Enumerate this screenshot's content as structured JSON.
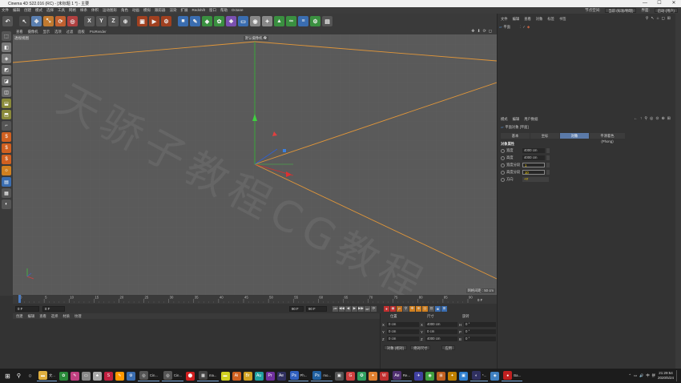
{
  "window": {
    "title": "Cinema 4D S22.016 (RC) - [未标题 1 *] - 主要",
    "controls": [
      "—",
      "☐",
      "✕"
    ]
  },
  "menubar": {
    "items": [
      "文件",
      "编辑",
      "创建",
      "模式",
      "选择",
      "工具",
      "网格",
      "样条",
      "体积",
      "运动图形",
      "角色",
      "动画",
      "模拟",
      "跟踪器",
      "渲染",
      "扩展",
      "Redshift",
      "窗口",
      "帮助",
      "Octane"
    ],
    "right": {
      "interface_label": "界面:",
      "interface_value": "启动 (用户)",
      "layout_label": "节点空间:",
      "layout_value": "当前 (标准/物理)"
    }
  },
  "toolbar": {
    "tools": [
      {
        "name": "undo",
        "glyph": "↶",
        "color": "#555"
      },
      {
        "name": "live-select",
        "glyph": "↖",
        "color": "#4a4a4a"
      },
      {
        "name": "move",
        "glyph": "✥",
        "color": "#5a7fb0"
      },
      {
        "name": "scale",
        "glyph": "⤡",
        "color": "#c07a30"
      },
      {
        "name": "rotate",
        "glyph": "⟳",
        "color": "#c06030"
      },
      {
        "name": "recent",
        "glyph": "◎",
        "color": "#b04040"
      },
      {
        "name": "axis-x",
        "glyph": "X",
        "color": "#555"
      },
      {
        "name": "axis-y",
        "glyph": "Y",
        "color": "#555"
      },
      {
        "name": "axis-z",
        "glyph": "Z",
        "color": "#555"
      },
      {
        "name": "coord",
        "glyph": "⊕",
        "color": "#555"
      },
      {
        "name": "render-region",
        "glyph": "▣",
        "color": "#a04020"
      },
      {
        "name": "render-view",
        "glyph": "▶",
        "color": "#a04020"
      },
      {
        "name": "render-settings",
        "glyph": "⚙",
        "color": "#a04020"
      },
      {
        "name": "cube",
        "glyph": "■",
        "color": "#3a6db0"
      },
      {
        "name": "pen",
        "glyph": "✎",
        "color": "#3a6db0"
      },
      {
        "name": "subdivide",
        "glyph": "◆",
        "color": "#3a9040"
      },
      {
        "name": "cloner",
        "glyph": "✿",
        "color": "#3a9040"
      },
      {
        "name": "deformer",
        "glyph": "❖",
        "color": "#7a50b0"
      },
      {
        "name": "floor",
        "glyph": "▭",
        "color": "#3a6db0"
      },
      {
        "name": "camera",
        "glyph": "◉",
        "color": "#888"
      },
      {
        "name": "light",
        "glyph": "✦",
        "color": "#888"
      },
      {
        "name": "terrain",
        "glyph": "▲",
        "color": "#3a9040"
      },
      {
        "name": "link",
        "glyph": "∞",
        "color": "#3a9040"
      },
      {
        "name": "stack",
        "glyph": "≡",
        "color": "#3a6db0"
      },
      {
        "name": "gear",
        "glyph": "⚙",
        "color": "#3a9040"
      },
      {
        "name": "display",
        "glyph": "▤",
        "color": "#555"
      }
    ]
  },
  "lefttools": [
    "⬚",
    "◧",
    "◈",
    "◩",
    "◪",
    "◫",
    "⬓",
    "⬒",
    "⌐",
    "$",
    "$",
    "$",
    "☼",
    "▤",
    "▦",
    "◐"
  ],
  "viewport": {
    "menu": [
      "查看",
      "摄像机",
      "显示",
      "选项",
      "过滤",
      "面板",
      "ProRender"
    ],
    "label": "透视视图",
    "camera": "默认摄像机 ✿",
    "grid_spacing": "网格间距 : 50 cm",
    "watermark": "天骄子教程CG教程",
    "icons": [
      "✥",
      "⬇",
      "⟳",
      "◻"
    ]
  },
  "timeline": {
    "ticks": [
      "0",
      "5",
      "10",
      "15",
      "20",
      "25",
      "30",
      "35",
      "40",
      "45",
      "50",
      "55",
      "60",
      "65",
      "70",
      "75",
      "80",
      "85",
      "90"
    ],
    "end_label": "0 F"
  },
  "transport": {
    "current_frame": "0 F",
    "start_frame": "0 F",
    "end_frame": "90 F",
    "end_frame2": "90 F",
    "buttons": [
      "⏮",
      "◀◀",
      "◀",
      "▶",
      "▶▶",
      "⏭",
      "⟳"
    ],
    "key_buttons": [
      "●",
      "◉",
      "P",
      "⚲",
      "✥",
      "⊕",
      "◎",
      "⊡",
      "◙",
      "⊞"
    ]
  },
  "materials": {
    "menu": [
      "创建",
      "编辑",
      "查看",
      "选择",
      "材质",
      "纹理"
    ]
  },
  "coords": {
    "headers": [
      "位置",
      "尺寸",
      "旋转"
    ],
    "rows": [
      {
        "axis": "X",
        "pos": "0 cm",
        "size_axis": "X",
        "size": "4000 cm",
        "rot_axis": "H",
        "rot": "0 °"
      },
      {
        "axis": "Y",
        "pos": "0 cm",
        "size_axis": "Y",
        "size": "0 cm",
        "rot_axis": "P",
        "rot": "0 °"
      },
      {
        "axis": "Z",
        "pos": "0 cm",
        "size_axis": "Z",
        "size": "4000 cm",
        "rot_axis": "B",
        "rot": "0 °"
      }
    ],
    "mode1": "对象 (相对)",
    "mode2": "绝对尺寸",
    "apply": "应用"
  },
  "objects": {
    "menu": [
      "文件",
      "编辑",
      "查看",
      "对象",
      "标签",
      "书签"
    ],
    "item": "平面",
    "icons": [
      "⚲",
      "↖",
      "⌂",
      "◻",
      "⊞"
    ]
  },
  "attributes": {
    "menu": [
      "模式",
      "编辑",
      "用户数据"
    ],
    "title": "平面对象 [平面]",
    "tabs": [
      {
        "label": "基本",
        "selected": false
      },
      {
        "label": "坐标",
        "selected": false
      },
      {
        "label": "对象",
        "selected": true
      },
      {
        "label": "平滑着色(Phong)",
        "selected": false
      }
    ],
    "section": "对象属性",
    "rows": [
      {
        "label": "宽度",
        "value": "4000 cm",
        "kind": "num"
      },
      {
        "label": "高度",
        "value": "4000 cm",
        "kind": "num"
      },
      {
        "label": "宽度分段",
        "value": "1",
        "kind": "edit"
      },
      {
        "label": "高度分段",
        "value": "10",
        "kind": "edit"
      },
      {
        "label": "方向",
        "value": "+Y",
        "kind": "select"
      }
    ],
    "icons": [
      "←",
      "↑",
      "⚲",
      "◎",
      "⊙",
      "⊕",
      "⊞"
    ]
  },
  "taskbar": {
    "start": "⊞",
    "search": "⚲",
    "task": "○",
    "apps": [
      {
        "label": "文...",
        "color": "#e0b040",
        "glyph": "▬"
      },
      {
        "label": "",
        "color": "#2a8a3a",
        "glyph": "✿"
      },
      {
        "label": "",
        "color": "#c04080",
        "glyph": "✎"
      },
      {
        "label": "",
        "color": "#888",
        "glyph": "▭"
      },
      {
        "label": "",
        "color": "#aaa",
        "glyph": "♣"
      },
      {
        "label": "",
        "color": "#c02040",
        "glyph": "S"
      },
      {
        "label": "",
        "color": "#ff9900",
        "glyph": "✎"
      },
      {
        "label": "",
        "color": "#3a6db0",
        "glyph": "⚙"
      },
      {
        "label": "Cin...",
        "color": "#555",
        "glyph": "◎"
      },
      {
        "label": "Cin...",
        "color": "#555",
        "glyph": "◎"
      },
      {
        "label": "",
        "color": "#d02020",
        "glyph": "⬤"
      },
      {
        "label": "ma...",
        "color": "#444",
        "glyph": "▦"
      },
      {
        "label": "",
        "color": "#d0d020",
        "glyph": "▬"
      },
      {
        "label": "",
        "color": "#d06020",
        "glyph": "Ai"
      },
      {
        "label": "",
        "color": "#d0a020",
        "glyph": "Br"
      },
      {
        "label": "",
        "color": "#20a0a0",
        "glyph": "Au"
      },
      {
        "label": "",
        "color": "#7030a0",
        "glyph": "Pr"
      },
      {
        "label": "",
        "color": "#303060",
        "glyph": "Ae"
      },
      {
        "label": "Ph...",
        "color": "#3060c0",
        "glyph": "Ps"
      },
      {
        "label": "mo...",
        "color": "#2060a0",
        "glyph": "Ps"
      },
      {
        "label": "",
        "color": "#555",
        "glyph": "▣"
      },
      {
        "label": "",
        "color": "#d04040",
        "glyph": "G"
      },
      {
        "label": "",
        "color": "#30a060",
        "glyph": "✪"
      },
      {
        "label": "",
        "color": "#e08030",
        "glyph": "✦"
      },
      {
        "label": "",
        "color": "#c03030",
        "glyph": "W"
      },
      {
        "label": "Re...",
        "color": "#503070",
        "glyph": "Ae"
      },
      {
        "label": "",
        "color": "#4040a0",
        "glyph": "✈"
      },
      {
        "label": "",
        "color": "#40a040",
        "glyph": "◉"
      },
      {
        "label": "",
        "color": "#c06020",
        "glyph": "⊞"
      },
      {
        "label": "",
        "color": "#c08000",
        "glyph": "✦"
      },
      {
        "label": "",
        "color": "#3080d0",
        "glyph": "▣"
      },
      {
        "label": "*...",
        "color": "#303060",
        "glyph": "◐"
      },
      {
        "label": "",
        "color": "#4080c0",
        "glyph": "◈"
      },
      {
        "label": "Ba...",
        "color": "#c02020",
        "glyph": "●"
      }
    ],
    "tray": {
      "time": "21:29:54",
      "date": "2020/5/24",
      "icons": [
        "⌃",
        "▭",
        "🔊",
        "中",
        "拼"
      ]
    }
  }
}
